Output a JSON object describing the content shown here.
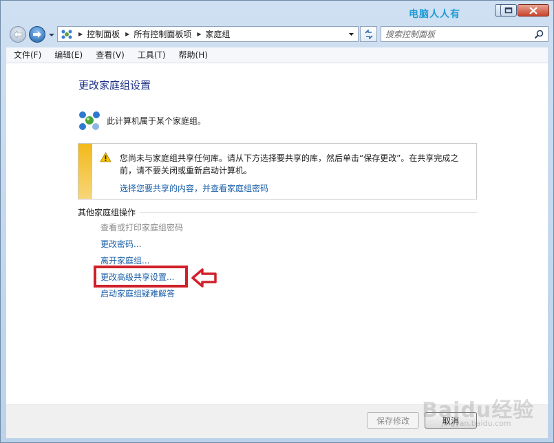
{
  "window": {
    "watermark_title": "电脑人人有",
    "controls": {
      "minimize_icon": "minimize-icon",
      "maximize_icon": "maximize-icon",
      "close_icon": "close-icon"
    }
  },
  "navigation": {
    "back_icon": "back-arrow-icon",
    "forward_icon": "forward-arrow-icon",
    "breadcrumb": [
      "控制面板",
      "所有控制面板项",
      "家庭组"
    ],
    "search": {
      "placeholder": "搜索控制面板",
      "value": ""
    }
  },
  "menu": [
    "文件(F)",
    "编辑(E)",
    "查看(V)",
    "工具(T)",
    "帮助(H)"
  ],
  "main": {
    "title": "更改家庭组设置",
    "status": "此计算机属于某个家庭组。",
    "info": {
      "message": "您尚未与家庭组共享任何库。请从下方选择要共享的库，然后单击“保存更改”。在共享完成之前，请不要关闭或重新启动计算机。",
      "link": "选择您要共享的内容，并查看家庭组密码"
    },
    "other_actions": {
      "title": "其他家庭组操作",
      "items": [
        {
          "label": "查看或打印家庭组密码",
          "enabled": false
        },
        {
          "label": "更改密码...",
          "enabled": true
        },
        {
          "label": "离开家庭组...",
          "enabled": true
        },
        {
          "label": "更改高级共享设置...",
          "enabled": true
        },
        {
          "label": "启动家庭组疑难解答",
          "enabled": true
        }
      ]
    }
  },
  "footer": {
    "save_label": "保存修改",
    "cancel_label": "取消"
  },
  "watermark": {
    "logo": "Baidu经验",
    "url": "jingyan.baidu.com"
  },
  "colors": {
    "link": "#1a5fa8",
    "title": "#1e3287",
    "highlight": "#d0202a",
    "warning_stripe": "#f3b91a"
  }
}
